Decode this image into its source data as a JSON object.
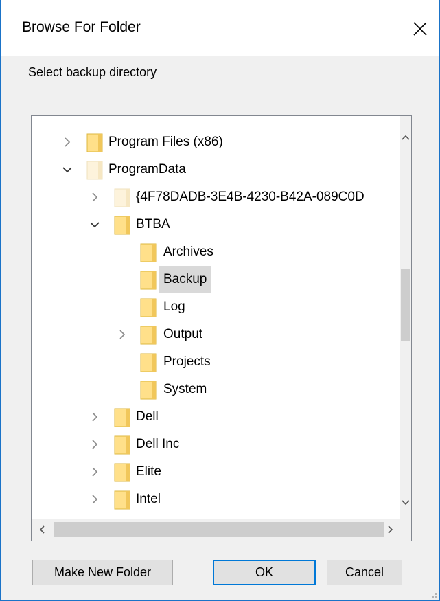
{
  "dialog": {
    "title": "Browse For Folder",
    "instruction": "Select backup directory"
  },
  "tree": {
    "items": [
      {
        "label": "Program Files (x86)",
        "expander": "collapsed",
        "folder_style": "normal"
      },
      {
        "label": "ProgramData",
        "expander": "expanded",
        "folder_style": "faded"
      },
      {
        "label": "{4F78DADB-3E4B-4230-B42A-089C0D",
        "expander": "collapsed",
        "folder_style": "faded"
      },
      {
        "label": "BTBA",
        "expander": "expanded",
        "folder_style": "normal"
      },
      {
        "label": "Archives",
        "expander": "none",
        "folder_style": "normal"
      },
      {
        "label": "Backup",
        "expander": "none",
        "folder_style": "normal",
        "selected": true
      },
      {
        "label": "Log",
        "expander": "none",
        "folder_style": "normal"
      },
      {
        "label": "Output",
        "expander": "collapsed",
        "folder_style": "normal"
      },
      {
        "label": "Projects",
        "expander": "none",
        "folder_style": "normal"
      },
      {
        "label": "System",
        "expander": "none",
        "folder_style": "normal"
      },
      {
        "label": "Dell",
        "expander": "collapsed",
        "folder_style": "normal"
      },
      {
        "label": "Dell Inc",
        "expander": "collapsed",
        "folder_style": "normal"
      },
      {
        "label": "Elite",
        "expander": "collapsed",
        "folder_style": "normal"
      },
      {
        "label": "Intel",
        "expander": "collapsed",
        "folder_style": "normal"
      }
    ]
  },
  "buttons": {
    "make_new_folder": "Make New Folder",
    "ok": "OK",
    "cancel": "Cancel"
  },
  "colors": {
    "folder_fill": "#ffe08a",
    "folder_border": "#dcb73f",
    "accent": "#0078d7",
    "selection": "#d9d9d9"
  }
}
